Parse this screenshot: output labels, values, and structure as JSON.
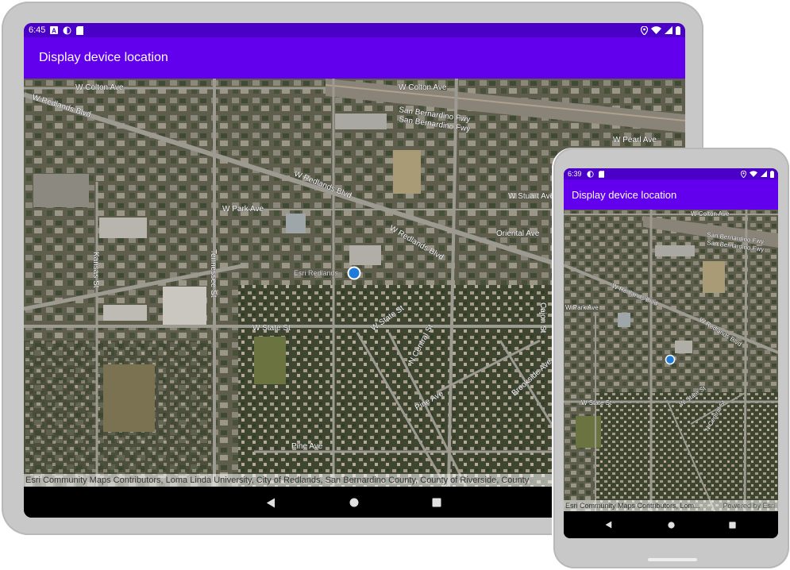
{
  "tablet": {
    "status_bar": {
      "time": "6:45",
      "left_icons": [
        "a-letter-icon",
        "halfcircle-icon",
        "sdcard-icon"
      ],
      "right_icons": [
        "location-pin-icon",
        "wifi-icon",
        "signal-icon",
        "battery-icon"
      ]
    },
    "app_bar": {
      "title": "Display device location"
    },
    "map": {
      "road_labels": {
        "w_colton_ave_1": "W Colton Ave",
        "w_colton_ave_2": "W Colton Ave",
        "w_redlands_blvd_1": "W Redlands Blvd",
        "w_redlands_blvd_2": "W Redlands Blvd",
        "w_redlands_blvd_3": "W Redlands Blvd",
        "san_bernardino_fwy_1": "San Bernardino Fwy",
        "san_bernardino_fwy_2": "San Bernardino Fwy",
        "w_pearl_ave": "W Pearl Ave",
        "w_stuart_ave": "W Stuart Ave",
        "w_park_ave": "W Park Ave",
        "oriental_ave": "Oriental Ave",
        "kansas_st": "Kansas St",
        "tennessee_st": "Tennessee St",
        "w_state_st_1": "W State St",
        "w_state_st_2": "W State St",
        "n_central_st": "N Central St",
        "pine_ave_1": "Pine Ave",
        "pine_ave_2": "Pine Ave",
        "brookside_ave": "Brookside Ave",
        "cajon_st": "Cajon St",
        "esri_redlands": "Esri Redlands"
      },
      "attribution": "Esri Community Maps Contributors, Loma Linda University, City of Redlands, San Bernardino County, County of Riverside, County"
    },
    "nav_bar": {
      "buttons": [
        "back-icon",
        "home-icon",
        "recents-icon"
      ]
    }
  },
  "phone": {
    "status_bar": {
      "time": "6:39",
      "left_icons": [
        "halfcircle-icon",
        "sdcard-icon"
      ],
      "right_icons": [
        "location-pin-icon",
        "wifi-icon",
        "signal-icon",
        "battery-icon"
      ]
    },
    "app_bar": {
      "title": "Display device location"
    },
    "map": {
      "road_labels": {
        "w_colton_ave": "W Colton Ave",
        "san_bernardino_fwy_1": "San Bernardino Fwy",
        "san_bernardino_fwy_2": "San Bernardino Fwy",
        "w_redlands_blvd_1": "W Redlands Blvd",
        "w_redlands_blvd_2": "W Redlands Blvd",
        "w_park_ave": "W Park Ave",
        "w_state_st_1": "W State St",
        "w_state_st_2": "W State St",
        "n_central_st": "N Central St"
      },
      "attribution": "Esri Community Maps Contributors, Lom...",
      "powered_by": "Powered by Esri"
    },
    "nav_bar": {
      "buttons": [
        "back-icon",
        "home-icon",
        "recents-icon"
      ]
    }
  },
  "colors": {
    "status_bar": "#4a00c6",
    "app_bar": "#6200ee",
    "location_dot": "#1e7bd9",
    "device_frame": "#c8c8c8"
  }
}
